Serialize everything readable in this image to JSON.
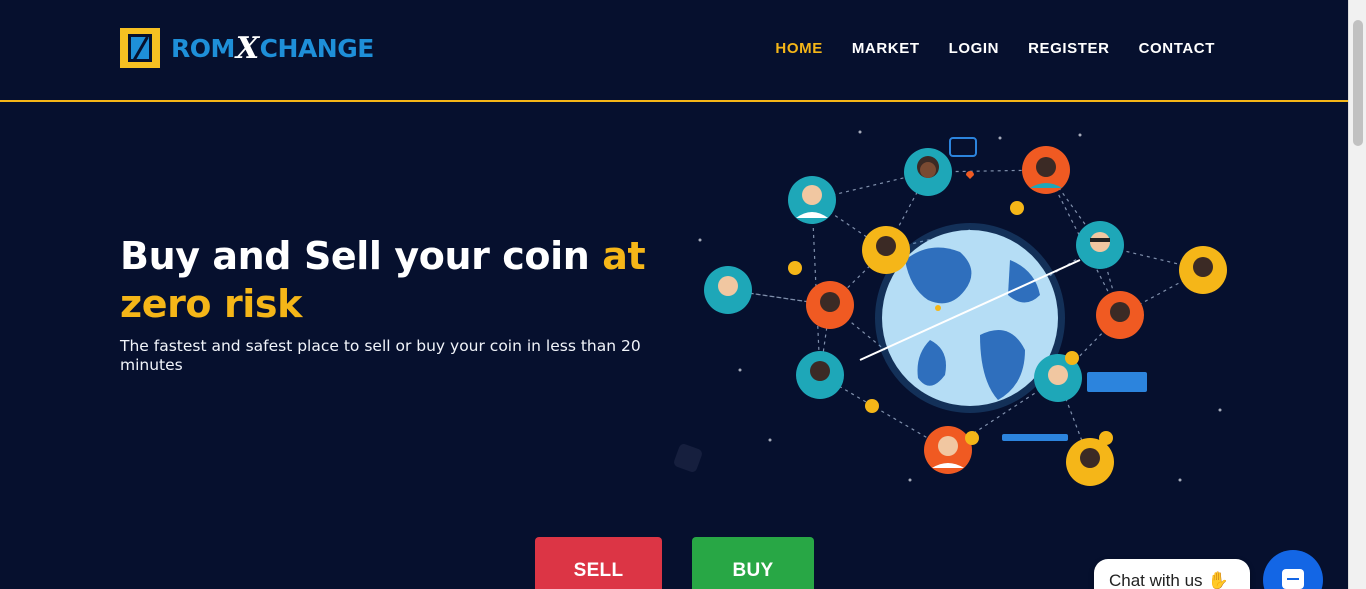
{
  "brand": {
    "logo_prefix": "ROM",
    "logo_x": "X",
    "logo_suffix": "CHANGE"
  },
  "nav": {
    "items": [
      {
        "label": "HOME",
        "active": true
      },
      {
        "label": "MARKET",
        "active": false
      },
      {
        "label": "LOGIN",
        "active": false
      },
      {
        "label": "REGISTER",
        "active": false
      },
      {
        "label": "CONTACT",
        "active": false
      }
    ]
  },
  "hero": {
    "title_main": "Buy and Sell your coin ",
    "title_highlight": "at zero risk",
    "subtitle": "The fastest and safest place to sell or buy your coin in less than 20 minutes"
  },
  "actions": {
    "sell_label": "SELL",
    "buy_label": "BUY"
  },
  "chat": {
    "bubble_text": "Chat with us",
    "wave_icon": "waving-hand-icon",
    "fab_icon": "chat-icon"
  },
  "illustration": {
    "icon": "global-network-icon"
  },
  "colors": {
    "background": "#06102e",
    "accent": "#f5b618",
    "brand_blue": "#1e8fd8",
    "sell": "#dc3545",
    "buy": "#28a745",
    "chat_fab": "#1366e5"
  }
}
